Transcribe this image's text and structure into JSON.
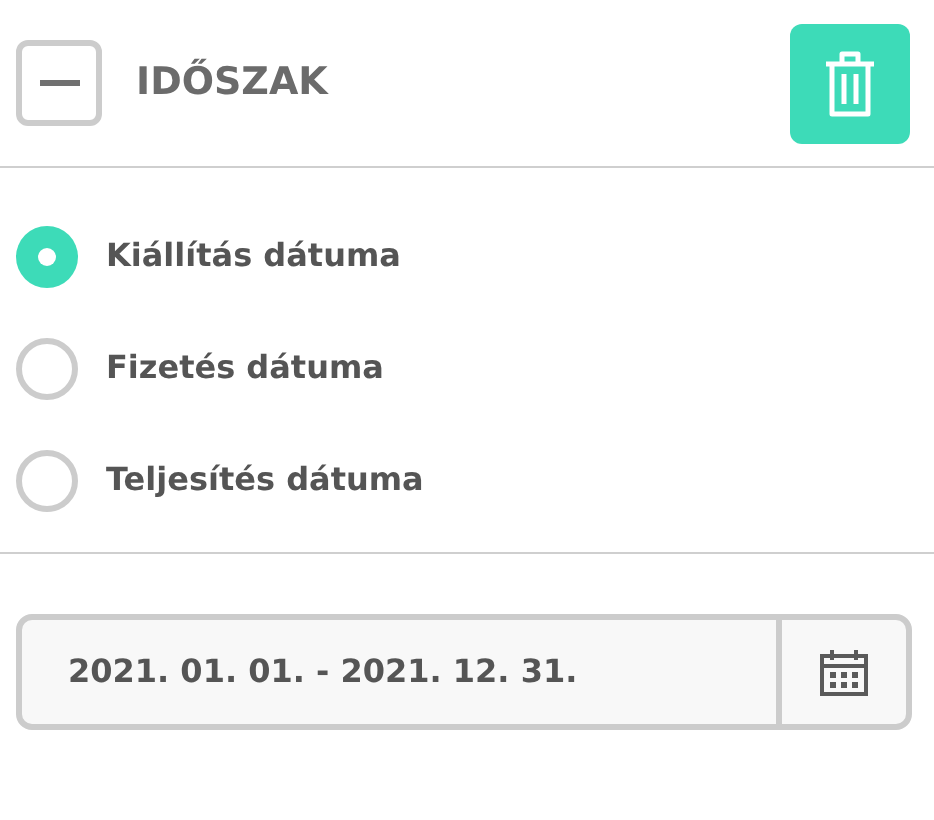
{
  "header": {
    "title": "IDŐSZAK",
    "expanded": true
  },
  "date_options": [
    {
      "label": "Kiállítás dátuma",
      "selected": true
    },
    {
      "label": "Fizetés dátuma",
      "selected": false
    },
    {
      "label": "Teljesítés dátuma",
      "selected": false
    }
  ],
  "date_range": {
    "value": "2021. 01. 01. - 2021. 12. 31."
  }
}
